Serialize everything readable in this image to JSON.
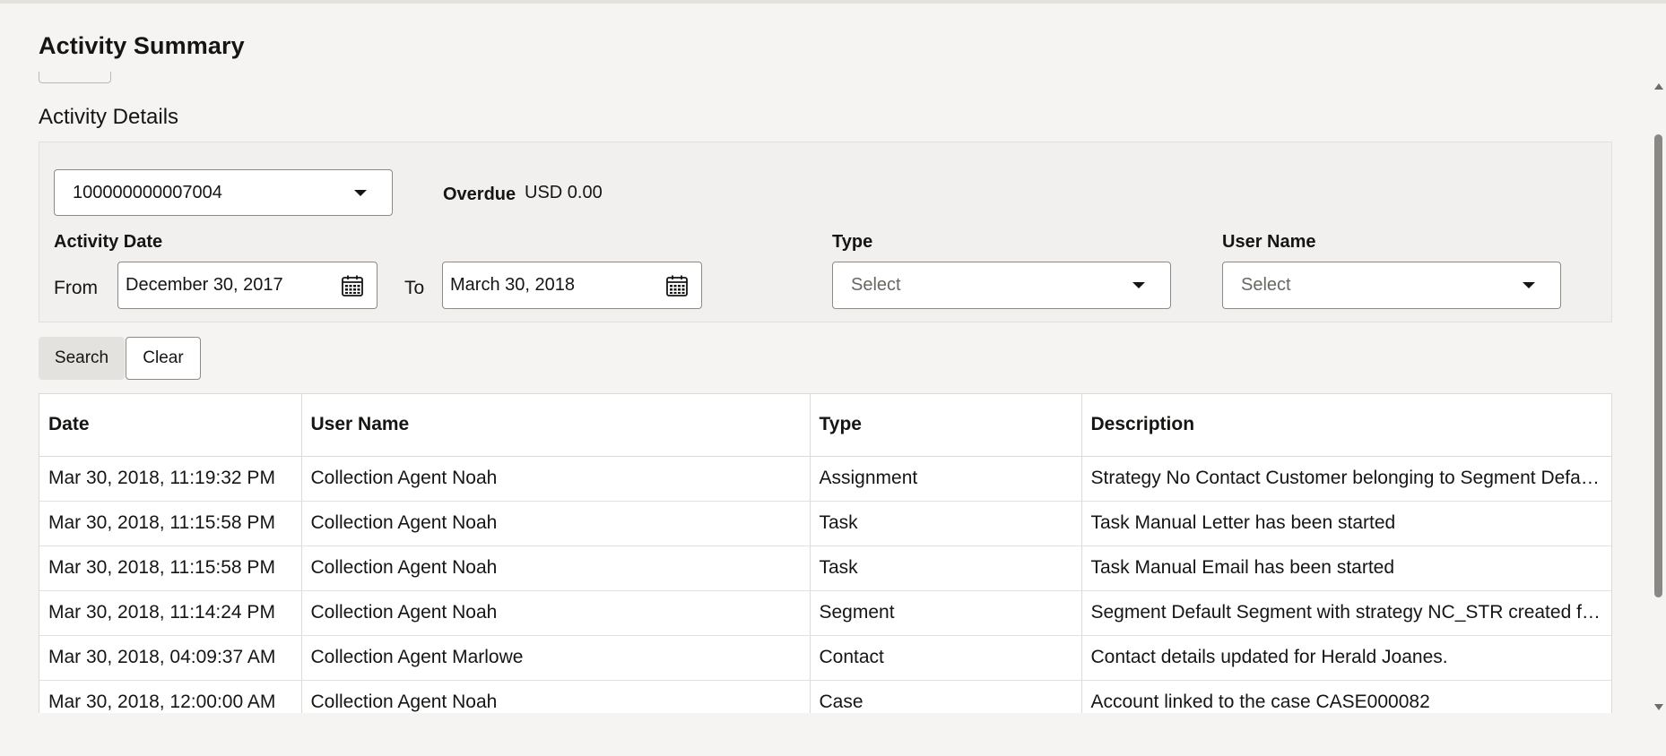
{
  "page": {
    "title": "Activity Summary",
    "section_title": "Activity Details"
  },
  "filters": {
    "account_number": "100000000007004",
    "overdue_label": "Overdue",
    "overdue_value": "USD 0.00",
    "activity_date_label": "Activity Date",
    "from_label": "From",
    "from_date": "December 30, 2017",
    "to_label": "To",
    "to_date": "March 30, 2018",
    "type_label": "Type",
    "type_placeholder": "Select",
    "user_name_label": "User Name",
    "user_name_placeholder": "Select"
  },
  "buttons": {
    "search": "Search",
    "clear": "Clear"
  },
  "table": {
    "headers": [
      "Date",
      "User Name",
      "Type",
      "Description"
    ],
    "rows": [
      [
        "Mar 30, 2018, 11:19:32 PM",
        "Collection Agent Noah",
        "Assignment",
        "Strategy No Contact Customer belonging to Segment Default Segment assigned"
      ],
      [
        "Mar 30, 2018, 11:15:58 PM",
        "Collection Agent Noah",
        "Task",
        "Task Manual Letter has been started"
      ],
      [
        "Mar 30, 2018, 11:15:58 PM",
        "Collection Agent Noah",
        "Task",
        "Task Manual Email has been started"
      ],
      [
        "Mar 30, 2018, 11:14:24 PM",
        "Collection Agent Noah",
        "Segment",
        "Segment Default Segment with strategy NC_STR created for the account"
      ],
      [
        "Mar 30, 2018, 04:09:37 AM",
        "Collection Agent Marlowe",
        "Contact",
        "Contact details updated for Herald Joanes."
      ],
      [
        "Mar 30, 2018, 12:00:00 AM",
        "Collection Agent Noah",
        "Case",
        "Account linked to the case CASE000082"
      ]
    ]
  },
  "icons": {
    "dropdown": "chevron-down-icon",
    "calendar": "calendar-icon"
  }
}
